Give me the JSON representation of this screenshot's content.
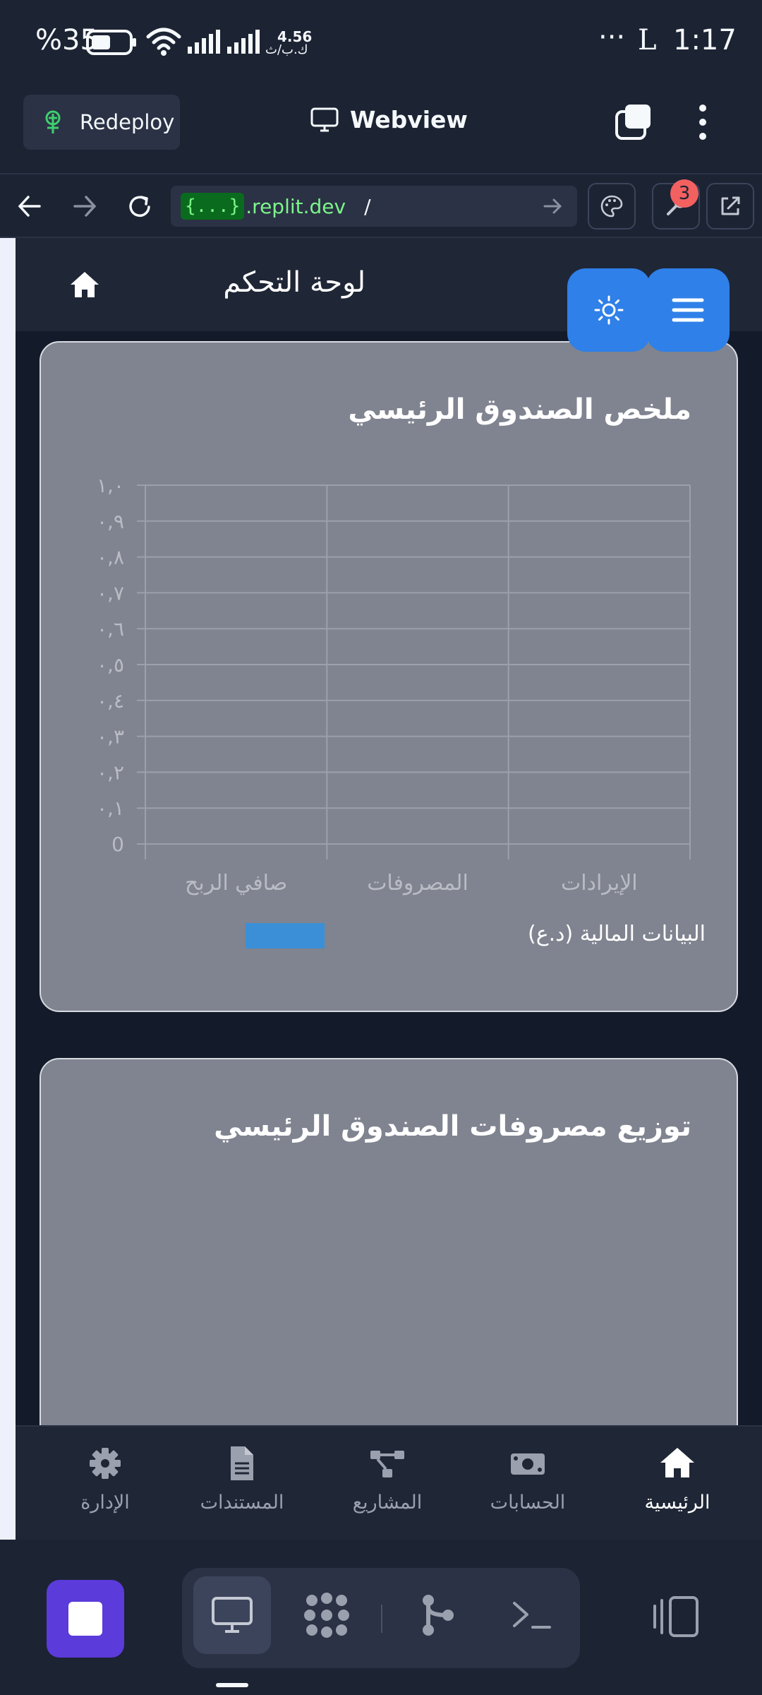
{
  "status_bar": {
    "battery_text": "%35",
    "speed_value": "4.56",
    "speed_unit": "ك.ب/ث",
    "more": "···",
    "carrier_glyph": "L",
    "time": "1:17"
  },
  "replit_header": {
    "redeploy_label": "Redeploy",
    "webview_label": "Webview"
  },
  "url_bar": {
    "badge": "{...}",
    "host": ".replit.dev",
    "path": "/",
    "notification_count": "3"
  },
  "app": {
    "header_title": "لوحة التحكم",
    "cards": [
      {
        "title": "ملخص الصندوق الرئيسي"
      },
      {
        "title": "توزيع مصروفات الصندوق الرئيسي"
      }
    ],
    "bottom_nav": [
      {
        "label": "الرئيسية",
        "icon": "home-icon",
        "active": true
      },
      {
        "label": "الحسابات",
        "icon": "money-bill-icon",
        "active": false
      },
      {
        "label": "المشاريع",
        "icon": "project-diagram-icon",
        "active": false
      },
      {
        "label": "المستندات",
        "icon": "file-icon",
        "active": false
      },
      {
        "label": "الإدارة",
        "icon": "gear-icon",
        "active": false
      }
    ]
  },
  "colors": {
    "accent": "#2f80e8",
    "series": "#3b8fd6",
    "card_bg": "#808490",
    "app_bg": "#131a2a"
  },
  "chart_data": {
    "type": "bar",
    "categories": [
      "الإيرادات",
      "المصروفات",
      "صافي الربح"
    ],
    "series": [
      {
        "name": "البيانات المالية (د.ع)",
        "values": [
          0,
          0,
          0
        ]
      }
    ],
    "yticks": [
      "0",
      "٠,١",
      "٠,٢",
      "٠,٣",
      "٠,٤",
      "٠,٥",
      "٠,٦",
      "٠,٧",
      "٠,٨",
      "٠,٩",
      "١,٠"
    ],
    "ylim": [
      0,
      1
    ],
    "grid": true,
    "legend": "bottom"
  }
}
